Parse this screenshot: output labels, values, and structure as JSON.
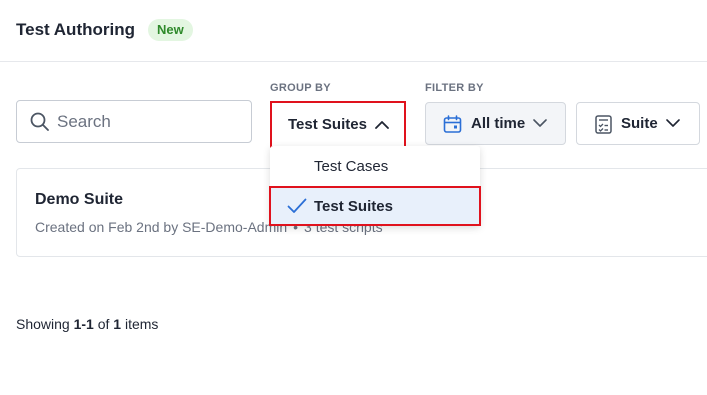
{
  "header": {
    "title": "Test Authoring",
    "badge": "New"
  },
  "toolbar": {
    "group_by_label": "GROUP BY",
    "filter_by_label": "FILTER BY",
    "search": {
      "placeholder": "Search",
      "value": ""
    },
    "group_by_button": "Test Suites",
    "time_filter": "All time",
    "type_filter": "Suite"
  },
  "group_dropdown": {
    "options": [
      {
        "label": "Test Cases",
        "selected": false
      },
      {
        "label": "Test Suites",
        "selected": true
      }
    ]
  },
  "suites": [
    {
      "name": "Demo Suite",
      "created": "Created on Feb 2nd by SE-Demo-Admin",
      "separator": "•",
      "scripts": "3 test scripts"
    }
  ],
  "footer": {
    "prefix": "Showing",
    "range": "1-1",
    "of": "of",
    "total": "1",
    "suffix": "items"
  },
  "colors": {
    "highlight_outline": "#e0121d",
    "badge_bg": "#e3f6e1",
    "badge_text": "#2f8a2b",
    "selected_bg": "#e8f0fb",
    "accent_blue": "#2b6fd6"
  }
}
